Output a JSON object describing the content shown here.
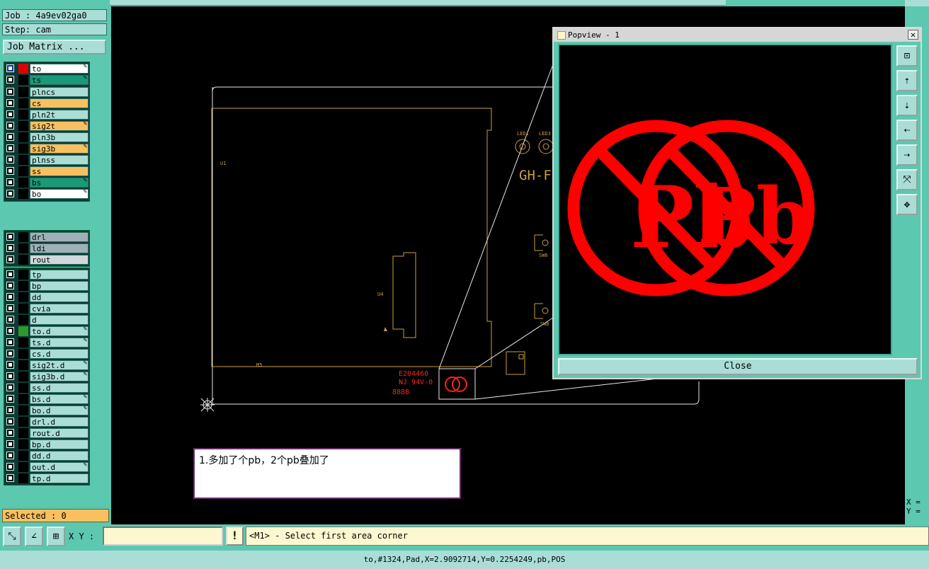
{
  "header": {
    "job_label": "Job : 4a9ev02ga0",
    "step_label": "Step: cam",
    "job_matrix_button": "Job Matrix ..."
  },
  "layers": [
    {
      "name": "to",
      "color": "#ffffff",
      "swatch": "#e00000",
      "edit": true,
      "active": true
    },
    {
      "name": "ts",
      "color": "#1a9a78",
      "swatch": "#000000",
      "edit": true
    },
    {
      "name": "plncs",
      "color": "#a9ddd6",
      "swatch": "#000000",
      "edit": false
    },
    {
      "name": "cs",
      "color": "#f8c060",
      "swatch": "#000000",
      "edit": false
    },
    {
      "name": "pln2t",
      "color": "#a9ddd6",
      "swatch": "#000000",
      "edit": false
    },
    {
      "name": "sig2t",
      "color": "#f8c060",
      "swatch": "#000000",
      "edit": true
    },
    {
      "name": "pln3b",
      "color": "#a9ddd6",
      "swatch": "#000000",
      "edit": false
    },
    {
      "name": "sig3b",
      "color": "#f8c060",
      "swatch": "#000000",
      "edit": true
    },
    {
      "name": "plnss",
      "color": "#a9ddd6",
      "swatch": "#000000",
      "edit": false
    },
    {
      "name": "ss",
      "color": "#f8c060",
      "swatch": "#000000",
      "edit": false
    },
    {
      "name": "bs",
      "color": "#1a9a78",
      "swatch": "#000000",
      "edit": true
    },
    {
      "name": "bo",
      "color": "#ffffff",
      "swatch": "#000000",
      "edit": true
    },
    {
      "name": "drl",
      "color": "#9fb0b8",
      "swatch": "#000000",
      "edit": false
    },
    {
      "name": "ldi",
      "color": "#9fb0b8",
      "swatch": "#000000",
      "edit": false
    },
    {
      "name": "rout",
      "color": "#d0d8dc",
      "swatch": "#000000",
      "edit": false
    },
    {
      "name": "tp",
      "color": "#a9ddd6",
      "swatch": "#000000",
      "edit": false
    },
    {
      "name": "bp",
      "color": "#a9ddd6",
      "swatch": "#000000",
      "edit": false
    },
    {
      "name": "dd",
      "color": "#a9ddd6",
      "swatch": "#000000",
      "edit": false
    },
    {
      "name": "cvia",
      "color": "#a9ddd6",
      "swatch": "#000000",
      "edit": false
    },
    {
      "name": "d",
      "color": "#a9ddd6",
      "swatch": "#000000",
      "edit": false
    },
    {
      "name": "to.d",
      "color": "#a9ddd6",
      "swatch": "#2a9a2a",
      "edit": true
    },
    {
      "name": "ts.d",
      "color": "#a9ddd6",
      "swatch": "#000000",
      "edit": true
    },
    {
      "name": "cs.d",
      "color": "#a9ddd6",
      "swatch": "#000000",
      "edit": false
    },
    {
      "name": "sig2t.d",
      "color": "#a9ddd6",
      "swatch": "#000000",
      "edit": true
    },
    {
      "name": "sig3b.d",
      "color": "#a9ddd6",
      "swatch": "#000000",
      "edit": true
    },
    {
      "name": "ss.d",
      "color": "#a9ddd6",
      "swatch": "#000000",
      "edit": false
    },
    {
      "name": "bs.d",
      "color": "#a9ddd6",
      "swatch": "#000000",
      "edit": true
    },
    {
      "name": "bo.d",
      "color": "#a9ddd6",
      "swatch": "#000000",
      "edit": true
    },
    {
      "name": "drl.d",
      "color": "#a9ddd6",
      "swatch": "#000000",
      "edit": false
    },
    {
      "name": "rout.d",
      "color": "#a9ddd6",
      "swatch": "#000000",
      "edit": false
    },
    {
      "name": "bp.d",
      "color": "#a9ddd6",
      "swatch": "#000000",
      "edit": false
    },
    {
      "name": "dd.d",
      "color": "#a9ddd6",
      "swatch": "#000000",
      "edit": false
    },
    {
      "name": "out.d",
      "color": "#a9ddd6",
      "swatch": "#000000",
      "edit": true
    },
    {
      "name": "tp.d",
      "color": "#a9ddd6",
      "swatch": "#000000",
      "edit": false
    }
  ],
  "selected_label": "Selected : 0",
  "board": {
    "title_text": "GH-F",
    "comp_labels": [
      "U1",
      "U4",
      "M5",
      "LED1",
      "LED3",
      "SW6",
      "SW8"
    ],
    "marking_line1": "E204460",
    "marking_line2": "NJ 94V-0",
    "marking_line3": "8888"
  },
  "popview": {
    "title": "Popview - 1",
    "close_button": "Close",
    "close_x": "✕",
    "symbol_text": "Pb",
    "symbol_color": "#ff0000"
  },
  "note_text": "1.多加了个pb，2个pb叠加了",
  "toolbar": {
    "xy_label": "X Y :",
    "xy_value": "",
    "prompt": "<M1> - Select first area corner"
  },
  "coords": {
    "x_label": "X =",
    "y_label": "Y ="
  },
  "status_line": "to,#1324,Pad,X=2.9092714,Y=0.2254249,pb,POS"
}
